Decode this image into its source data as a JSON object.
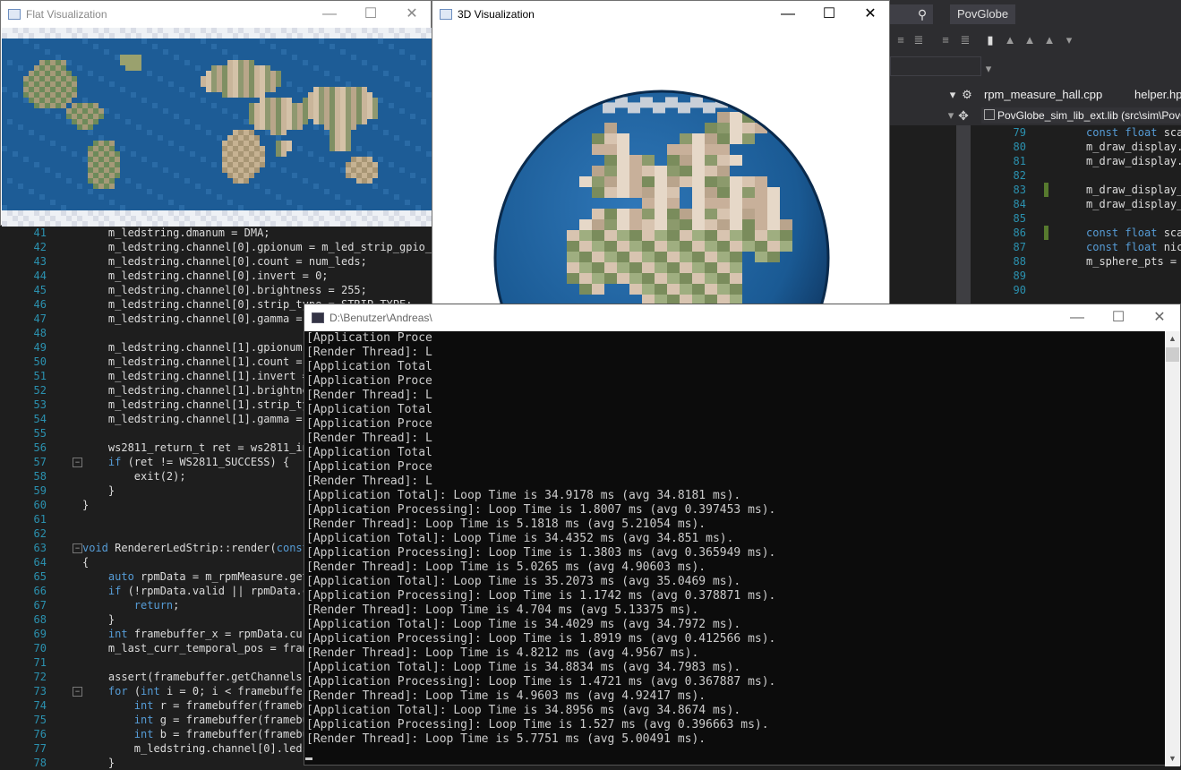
{
  "ide": {
    "title": "PovGlobe",
    "tabs": [
      "rpm_measure_hall.cpp",
      "helper.hpp"
    ],
    "nav_file": "PovGlobe_sim_lib_ext.lib (src\\sim\\PovGlobe...",
    "right_lines": [
      {
        "n": "79",
        "code": "const float sca",
        "chg": false
      },
      {
        "n": "80",
        "code": "m_draw_display.",
        "chg": false
      },
      {
        "n": "81",
        "code": "m_draw_display.r",
        "chg": false
      },
      {
        "n": "82",
        "code": "",
        "chg": false
      },
      {
        "n": "83",
        "code": "m_draw_display_",
        "chg": true
      },
      {
        "n": "84",
        "code": "m_draw_display_",
        "chg": false
      },
      {
        "n": "85",
        "code": "",
        "chg": false
      },
      {
        "n": "86",
        "code": "const float sca",
        "chg": true
      },
      {
        "n": "87",
        "code": "const float nic",
        "chg": false
      },
      {
        "n": "88",
        "code": "m_sphere_pts =",
        "chg": false
      },
      {
        "n": "89",
        "code": "",
        "chg": false
      },
      {
        "n": "90",
        "code": "",
        "chg": false
      }
    ],
    "left_lines": [
      {
        "n": "41",
        "code": "    m_ledstring.dmanum = DMA;"
      },
      {
        "n": "42",
        "code": "    m_ledstring.channel[0].gpionum = m_led_strip_gpio_pi"
      },
      {
        "n": "43",
        "code": "    m_ledstring.channel[0].count = num_leds;"
      },
      {
        "n": "44",
        "code": "    m_ledstring.channel[0].invert = 0;"
      },
      {
        "n": "45",
        "code": "    m_ledstring.channel[0].brightness = 255;"
      },
      {
        "n": "46",
        "code": "    m_ledstring.channel[0].strip_type = STRIP_TYPE;"
      },
      {
        "n": "47",
        "code": "    m_ledstring.channel[0].gamma = "
      },
      {
        "n": "48",
        "code": ""
      },
      {
        "n": "49",
        "code": "    m_ledstring.channel[1].gpionum "
      },
      {
        "n": "50",
        "code": "    m_ledstring.channel[1].count = "
      },
      {
        "n": "51",
        "code": "    m_ledstring.channel[1].invert = "
      },
      {
        "n": "52",
        "code": "    m_ledstring.channel[1].brightne"
      },
      {
        "n": "53",
        "code": "    m_ledstring.channel[1].strip_ty"
      },
      {
        "n": "54",
        "code": "    m_ledstring.channel[1].gamma = "
      },
      {
        "n": "55",
        "code": ""
      },
      {
        "n": "56",
        "code": "    ws2811_return_t ret = ws2811_in"
      },
      {
        "n": "57",
        "code": "    if (ret != WS2811_SUCCESS) {"
      },
      {
        "n": "58",
        "code": "        exit(2);"
      },
      {
        "n": "59",
        "code": "    }"
      },
      {
        "n": "60",
        "code": "}"
      },
      {
        "n": "61",
        "code": ""
      },
      {
        "n": "62",
        "code": ""
      },
      {
        "n": "63",
        "code": "void RendererLedStrip::render(const"
      },
      {
        "n": "64",
        "code": "{"
      },
      {
        "n": "65",
        "code": "    auto rpmData = m_rpmMeasure.get"
      },
      {
        "n": "66",
        "code": "    if (!rpmData.valid || rpmData.c"
      },
      {
        "n": "67",
        "code": "        return;"
      },
      {
        "n": "68",
        "code": "    }"
      },
      {
        "n": "69",
        "code": "    int framebuffer_x = rpmData.cur"
      },
      {
        "n": "70",
        "code": "    m_last_curr_temporal_pos = fram"
      },
      {
        "n": "71",
        "code": ""
      },
      {
        "n": "72",
        "code": "    assert(framebuffer.getChannels("
      },
      {
        "n": "73",
        "code": "    for (int i = 0; i < framebuffer"
      },
      {
        "n": "74",
        "code": "        int r = framebuffer(framebu"
      },
      {
        "n": "75",
        "code": "        int g = framebuffer(framebu"
      },
      {
        "n": "76",
        "code": "        int b = framebuffer(framebu"
      },
      {
        "n": "77",
        "code": "        m_ledstring.channel[0].leds"
      },
      {
        "n": "78",
        "code": "    }"
      }
    ]
  },
  "flat_window": {
    "title": "Flat Visualization"
  },
  "globe_window": {
    "title": "3D Visualization"
  },
  "console_window": {
    "title": "D:\\Benutzer\\Andreas\\",
    "lines": [
      "[Application Proce",
      "[Render Thread]: L",
      "[Application Total",
      "[Application Proce",
      "[Render Thread]: L",
      "[Application Total",
      "[Application Proce",
      "[Render Thread]: L",
      "[Application Total",
      "[Application Proce",
      "[Render Thread]: L",
      "[Application Total]: Loop Time is 34.9178 ms (avg 34.8181 ms).",
      "[Application Processing]: Loop Time is 1.8007 ms (avg 0.397453 ms).",
      "[Render Thread]: Loop Time is 5.1818 ms (avg 5.21054 ms).",
      "[Application Total]: Loop Time is 34.4352 ms (avg 34.851 ms).",
      "[Application Processing]: Loop Time is 1.3803 ms (avg 0.365949 ms).",
      "[Render Thread]: Loop Time is 5.0265 ms (avg 4.90603 ms).",
      "[Application Total]: Loop Time is 35.2073 ms (avg 35.0469 ms).",
      "[Application Processing]: Loop Time is 1.1742 ms (avg 0.378871 ms).",
      "[Render Thread]: Loop Time is 4.704 ms (avg 5.13375 ms).",
      "[Application Total]: Loop Time is 34.4029 ms (avg 34.7972 ms).",
      "[Application Processing]: Loop Time is 1.8919 ms (avg 0.412566 ms).",
      "[Render Thread]: Loop Time is 4.8212 ms (avg 4.9567 ms).",
      "[Application Total]: Loop Time is 34.8834 ms (avg 34.7983 ms).",
      "[Application Processing]: Loop Time is 1.4721 ms (avg 0.367887 ms).",
      "[Render Thread]: Loop Time is 4.9603 ms (avg 4.92417 ms).",
      "[Application Total]: Loop Time is 34.8956 ms (avg 34.8674 ms).",
      "[Application Processing]: Loop Time is 1.527 ms (avg 0.396663 ms).",
      "[Render Thread]: Loop Time is 5.7751 ms (avg 5.00491 ms)."
    ]
  },
  "controls": {
    "minimize": "—",
    "maximize": "☐",
    "close": "✕"
  },
  "colors": {
    "ocean": "#1d5c96",
    "land": "#b9a68a",
    "ice": "#eef1f5",
    "console_bg": "#0c0c0c"
  }
}
